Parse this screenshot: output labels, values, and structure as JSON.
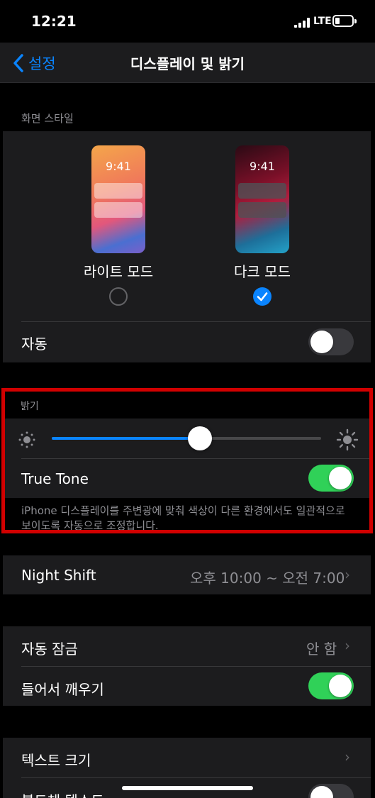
{
  "status_bar": {
    "time": "12:21",
    "network": "LTE"
  },
  "nav": {
    "back_label": "설정",
    "title": "디스플레이 및 밝기"
  },
  "appearance": {
    "section_label": "화면 스타일",
    "preview_time": "9:41",
    "light_label": "라이트 모드",
    "dark_label": "다크 모드",
    "selected": "dark",
    "auto_label": "자동",
    "auto_on": false
  },
  "brightness": {
    "section_label": "밝기",
    "level": 0.55,
    "true_tone_label": "True Tone",
    "true_tone_on": true,
    "footer": "iPhone 디스플레이를 주변광에 맞춰 색상이 다른 환경에서도 일관적으로 보이도록 자동으로 조정합니다."
  },
  "night_shift": {
    "label": "Night Shift",
    "value": "오후 10:00 ~ 오전 7:00"
  },
  "auto_lock": {
    "label": "자동 잠금",
    "value": "안 함"
  },
  "raise_to_wake": {
    "label": "들어서 깨우기",
    "on": true
  },
  "text_size": {
    "label": "텍스트 크기"
  },
  "bold_text": {
    "label": "볼드체 텍스트",
    "on": false
  },
  "colors": {
    "accent": "#0a84ff",
    "toggle_on": "#30d158",
    "toggle_off": "#39393d",
    "highlight": "#d10000"
  }
}
